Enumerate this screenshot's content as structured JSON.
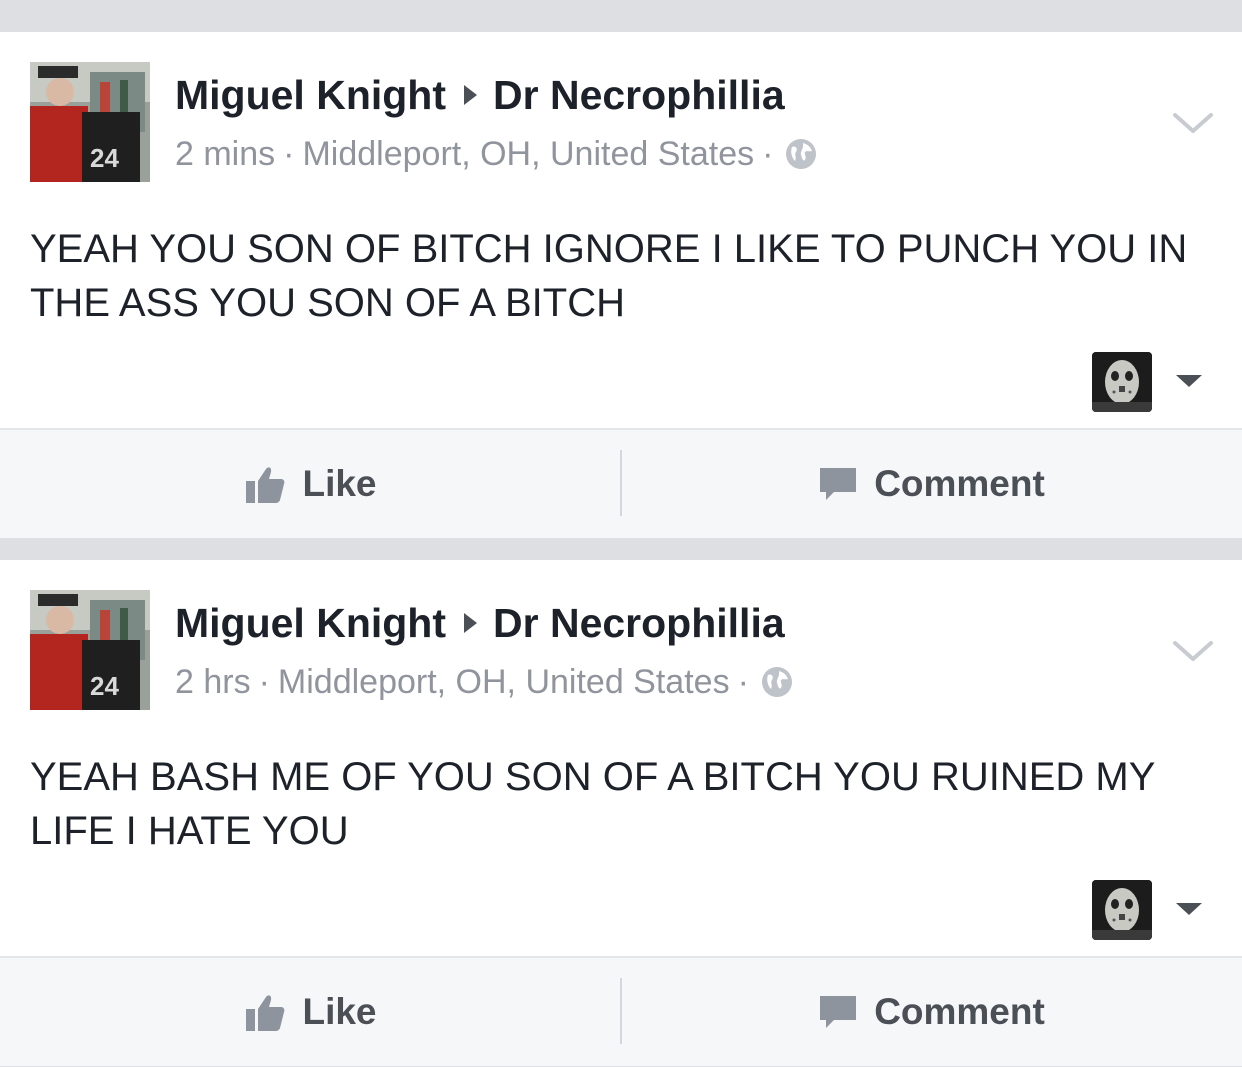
{
  "posts": [
    {
      "author": "Miguel Knight",
      "recipient": "Dr Necrophillia",
      "time": "2 mins",
      "location": "Middleport, OH, United States",
      "jersey_number": "24",
      "text": "YEAH YOU SON OF BITCH IGNORE I LIKE TO PUNCH YOU IN THE ASS YOU SON OF A BITCH",
      "like_label": "Like",
      "comment_label": "Comment"
    },
    {
      "author": "Miguel Knight",
      "recipient": "Dr Necrophillia",
      "time": "2 hrs",
      "location": "Middleport, OH, United States",
      "jersey_number": "24",
      "text": "YEAH BASH ME OF YOU SON OF A BITCH YOU RUINED MY LIFE I HATE YOU",
      "like_label": "Like",
      "comment_label": "Comment"
    }
  ],
  "icons": {
    "audience": "globe-icon",
    "options": "chevron-down-icon",
    "reaction_menu": "caret-down-icon",
    "like": "thumbs-up-icon",
    "comment": "speech-bubble-icon"
  },
  "colors": {
    "text_primary": "#1d2129",
    "text_secondary": "#90949c",
    "action_text": "#4b4f56",
    "feed_background": "#dddfe2",
    "action_bar_background": "#f6f7f9"
  }
}
